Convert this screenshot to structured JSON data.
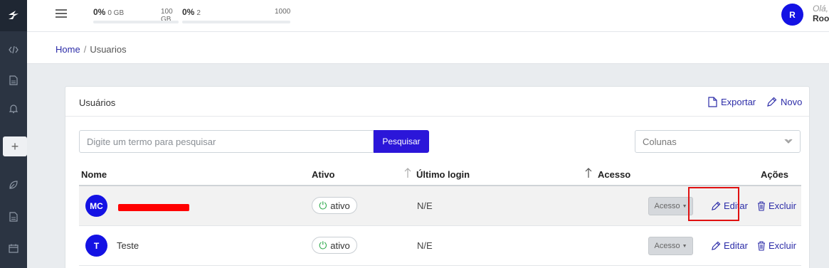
{
  "topbar": {
    "usage_storage": {
      "percent": "0%",
      "used": "0 GB",
      "max": "100 GB",
      "fill": 0
    },
    "usage_users": {
      "percent": "0%",
      "used": "2",
      "max": "1000",
      "fill": 0
    },
    "user": {
      "initial": "R",
      "greeting": "Olá,",
      "name": "Roo"
    }
  },
  "breadcrumb": {
    "home": "Home",
    "separator": "/",
    "current": "Usuarios"
  },
  "card": {
    "title": "Usuários",
    "export_label": "Exportar",
    "new_label": "Novo",
    "search_placeholder": "Digite um termo para pesquisar",
    "search_button": "Pesquisar",
    "columns_label": "Colunas",
    "headers": {
      "name": "Nome",
      "active": "Ativo",
      "last_login": "Último login",
      "access": "Acesso",
      "actions": "Ações"
    },
    "rows": [
      {
        "initials": "MC",
        "name": "",
        "status": "ativo",
        "last_login": "N/E",
        "access_btn": "Acesso",
        "edit": "Editar",
        "delete": "Excluir"
      },
      {
        "initials": "T",
        "name": "Teste",
        "status": "ativo",
        "last_login": "N/E",
        "access_btn": "Acesso",
        "edit": "Editar",
        "delete": "Excluir"
      }
    ]
  },
  "colors": {
    "primary": "#2b16d9",
    "avatar": "#1412e4",
    "link": "#2c2ca8",
    "sidebar": "#2b3442",
    "highlight": "#e01010"
  }
}
